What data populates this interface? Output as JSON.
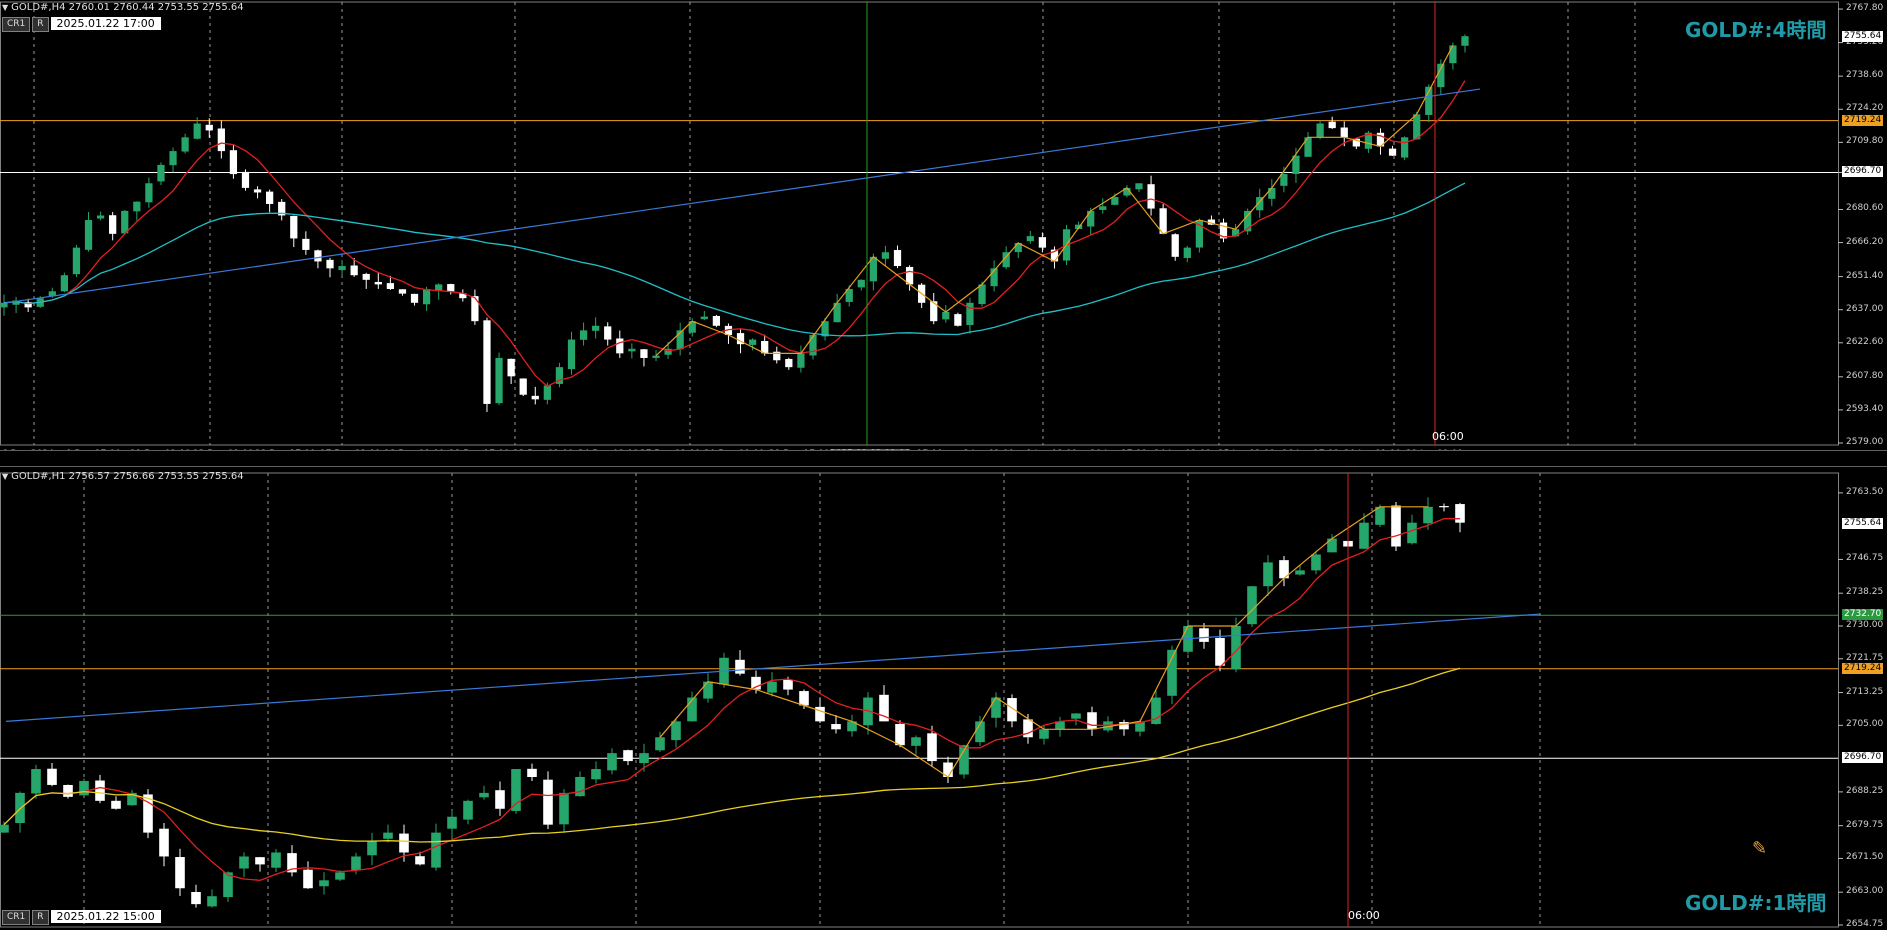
{
  "panes": [
    {
      "id": "top",
      "header": "GOLD#,H4  2760.01 2760.44 2753.55 2755.64",
      "button_cr": "CR1",
      "button_r": "R",
      "cursor_date": "2025.01.22  17:00",
      "corner_label": "GOLD#:4時間",
      "cursor_time_label": "06:00",
      "price_axis": [
        "2767.80",
        "2753.20",
        "2738.60",
        "2724.20",
        "2709.80",
        "2696.70",
        "2680.60",
        "2666.20",
        "2651.40",
        "2637.00",
        "2622.60",
        "2607.80",
        "2593.40",
        "2579.00"
      ],
      "time_axis": [
        "6 Dec 2024",
        "9 Dec 17:00",
        "11 Dec 01:00",
        "12 Dec 09:00",
        "13 Dec 17:00",
        "17 Dec 01:00",
        "18 Dec 09:00",
        "19 Dec 17:00",
        "23 Dec 01:00",
        "24 Dec 09:00",
        "27 Dec 01:00",
        "30 Dec 09:00",
        "31 Dec 17:00",
        "2025.01.03 01:00",
        "Jan 17:00",
        "8 Jan 01:00",
        "9 Jan 09:00",
        "10 Jan 17:00",
        "14 Jan 01:00",
        "15 Jan 09:00",
        "16 Jan 17:00",
        "20 Jan 01:00",
        "21 Jan 09:00"
      ],
      "levels": [
        {
          "name": "resistance",
          "value": 2719.24,
          "label": "2719.24",
          "color": "#f0a020"
        },
        {
          "name": "support",
          "value": 2696.7,
          "label": "2696.70",
          "color": "#ffffff"
        },
        {
          "name": "current",
          "value": 2755.64,
          "label": "2755.64",
          "color": "#ffffff"
        }
      ]
    },
    {
      "id": "bottom",
      "header": "GOLD#,H1  2756.57 2756.66 2753.55 2755.64",
      "button_cr": "CR1",
      "button_r": "R",
      "cursor_date": "2025.01.22  15:00",
      "corner_label": "GOLD#:1時間",
      "cursor_time_label": "06:00",
      "price_axis": [
        "2763.50",
        "2746.75",
        "2738.25",
        "2730.00",
        "2721.75",
        "2713.25",
        "2705.00",
        "2688.25",
        "2679.75",
        "2671.50",
        "2663.00",
        "2654.75"
      ],
      "levels": [
        {
          "name": "green",
          "value": 2732.7,
          "label": "2732.70",
          "color": "#2a9a40"
        },
        {
          "name": "resistance",
          "value": 2719.24,
          "label": "2719.24",
          "color": "#f0a020"
        },
        {
          "name": "support",
          "value": 2696.7,
          "label": "2696.70",
          "color": "#ffffff"
        },
        {
          "name": "current",
          "value": 2755.64,
          "label": "2755.64",
          "color": "#ffffff"
        }
      ]
    }
  ],
  "colors": {
    "bull": "#26a66b",
    "bear": "#ffffff",
    "ma_fast": "#e02020",
    "ma_slow_top": "#20c0c8",
    "ma_slow_bottom": "#e8d020",
    "trend": "#3a7ad8",
    "zigzag": "#e8a020",
    "cursor": "#e02020",
    "vline": "#20a020"
  },
  "chart_data": [
    {
      "type": "candlestick",
      "pane": "top",
      "ylim": [
        2579.0,
        2770.0
      ],
      "levels": [
        2719.24,
        2696.7
      ],
      "last_price": 2755.64,
      "close_series": [
        2640,
        2641,
        2638,
        2642,
        2645,
        2652,
        2664,
        2676,
        2678,
        2670,
        2680,
        2684,
        2692,
        2700,
        2706,
        2712,
        2718,
        2715,
        2706,
        2696,
        2690,
        2688,
        2683,
        2678,
        2668,
        2663,
        2658,
        2655,
        2656,
        2652,
        2650,
        2648,
        2646,
        2644,
        2640,
        2646,
        2648,
        2645,
        2642,
        2632,
        2596,
        2616,
        2608,
        2600,
        2598,
        2604,
        2612,
        2624,
        2628,
        2630,
        2624,
        2618,
        2620,
        2616,
        2617,
        2620,
        2628,
        2632,
        2634,
        2630,
        2626,
        2622,
        2624,
        2618,
        2615,
        2612,
        2618,
        2626,
        2632,
        2640,
        2646,
        2650,
        2660,
        2662,
        2656,
        2648,
        2640,
        2632,
        2636,
        2630,
        2640,
        2648,
        2655,
        2662,
        2666,
        2669,
        2664,
        2658,
        2672,
        2674,
        2680,
        2682,
        2686,
        2690,
        2692,
        2681,
        2670,
        2660,
        2664,
        2676,
        2674,
        2668,
        2672,
        2680,
        2686,
        2690,
        2696,
        2704,
        2712,
        2718,
        2716,
        2712,
        2708,
        2714,
        2708,
        2704,
        2712,
        2722,
        2734,
        2744,
        2752,
        2756
      ]
    },
    {
      "type": "candlestick",
      "pane": "bottom",
      "ylim": [
        2654.75,
        2768.0
      ],
      "levels": [
        2732.7,
        2719.24,
        2696.7
      ],
      "last_price": 2755.64,
      "close_series": [
        2680,
        2688,
        2694,
        2690,
        2687,
        2691,
        2686,
        2684,
        2688,
        2678,
        2672,
        2664,
        2660,
        2662,
        2668,
        2672,
        2670,
        2673,
        2668,
        2664,
        2666,
        2668,
        2672,
        2676,
        2678,
        2673,
        2670,
        2678,
        2682,
        2686,
        2688,
        2684,
        2694,
        2692,
        2680,
        2688,
        2692,
        2694,
        2698,
        2696,
        2698,
        2702,
        2706,
        2712,
        2716,
        2722,
        2718,
        2714,
        2716,
        2714,
        2710,
        2706,
        2704,
        2706,
        2712,
        2706,
        2700,
        2702,
        2696,
        2692,
        2700,
        2706,
        2712,
        2706,
        2702,
        2704,
        2706,
        2708,
        2704,
        2706,
        2704,
        2706,
        2712,
        2724,
        2730,
        2726,
        2720,
        2730,
        2740,
        2746,
        2742,
        2744,
        2748,
        2752,
        2750,
        2756,
        2760,
        2750,
        2756,
        2760,
        2760,
        2756
      ]
    }
  ]
}
